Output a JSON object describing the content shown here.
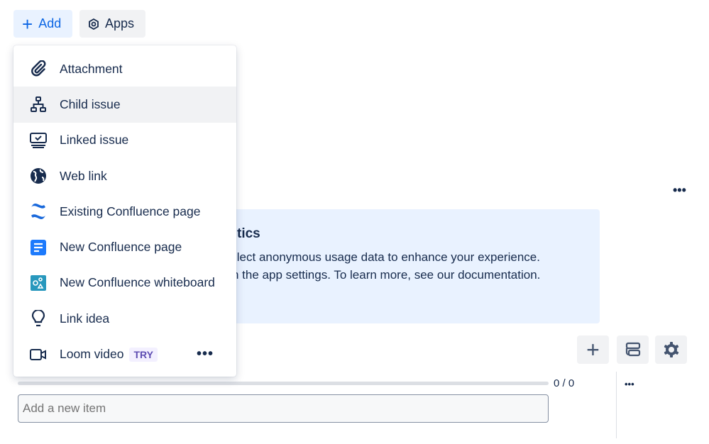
{
  "toolbar": {
    "add_label": "Add",
    "apps_label": "Apps"
  },
  "banner": {
    "title_fragment": "tics",
    "line1_fragment": "llect anonymous usage data to enhance your experience.",
    "line2_fragment": "n the app settings. To learn more, see our documentation."
  },
  "menu": {
    "items": [
      {
        "label": "Attachment",
        "icon": "paperclip-icon"
      },
      {
        "label": "Child issue",
        "icon": "hierarchy-icon",
        "highlighted": true
      },
      {
        "label": "Linked issue",
        "icon": "linked-issue-icon"
      },
      {
        "label": "Web link",
        "icon": "globe-icon"
      },
      {
        "label": "Existing Confluence page",
        "icon": "confluence-icon"
      },
      {
        "label": "New Confluence page",
        "icon": "page-icon"
      },
      {
        "label": "New Confluence whiteboard",
        "icon": "whiteboard-icon"
      },
      {
        "label": "Link idea",
        "icon": "lightbulb-icon"
      },
      {
        "label": "Loom video",
        "icon": "video-icon",
        "badge": "TRY"
      }
    ]
  },
  "checklist": {
    "progress": "0 / 0",
    "progress_fraction": 0,
    "input_placeholder": "Add a new item"
  },
  "colors": {
    "accent": "#0c66e4",
    "banner_bg": "#e9f2ff",
    "text": "#172b4d"
  }
}
